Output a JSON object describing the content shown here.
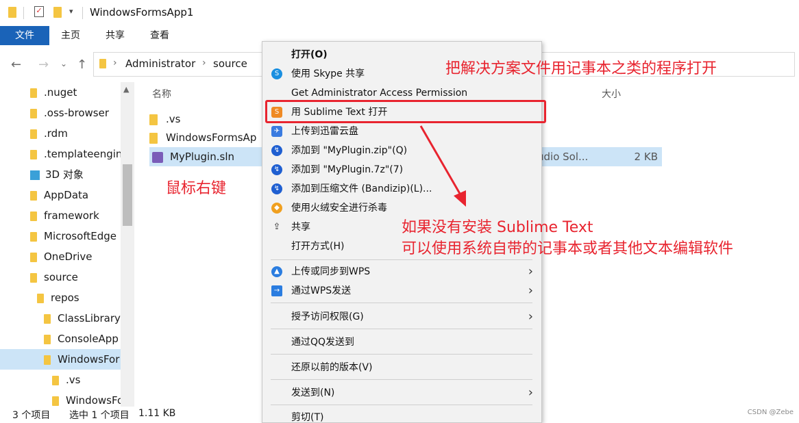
{
  "window": {
    "title": "WindowsFormsApp1"
  },
  "ribbon": {
    "tabs": [
      "文件",
      "主页",
      "共享",
      "查看"
    ]
  },
  "address": {
    "crumbs": [
      "Administrator",
      "source"
    ]
  },
  "sidebar": {
    "items": [
      ".nuget",
      ".oss-browser",
      ".rdm",
      ".templateengin",
      "3D 对象",
      "AppData",
      "framework",
      "MicrosoftEdge",
      "OneDrive",
      "source",
      "repos",
      "ClassLibrary",
      "ConsoleApp",
      "WindowsFor",
      ".vs",
      "WindowsFo"
    ]
  },
  "filelist": {
    "col_name": "名称",
    "col_size": "大小",
    "rows": [
      {
        "name": ".vs"
      },
      {
        "name": "WindowsFormsAp"
      },
      {
        "name": "MyPlugin.sln",
        "type": "udio Sol...",
        "size": "2 KB"
      }
    ]
  },
  "status": {
    "count": "3 个项目",
    "selected": "选中 1 个项目",
    "size": "1.11 KB"
  },
  "context_menu": {
    "items": [
      "打开(O)",
      "使用 Skype 共享",
      "Get Administrator Access Permission",
      "用 Sublime Text 打开",
      "上传到迅雷云盘",
      "添加到 \"MyPlugin.zip\"(Q)",
      "添加到 \"MyPlugin.7z\"(7)",
      "添加到压缩文件 (Bandizip)(L)...",
      "使用火绒安全进行杀毒",
      "共享",
      "打开方式(H)",
      "上传或同步到WPS",
      "通过WPS发送",
      "授予访问权限(G)",
      "通过QQ发送到",
      "还原以前的版本(V)",
      "发送到(N)",
      "剪切(T)"
    ]
  },
  "annotations": {
    "top": "把解决方案文件用记事本之类的程序打开",
    "right_click": "鼠标右键",
    "line1": "如果没有安装 Sublime Text",
    "line2": "可以使用系统自带的记事本或者其他文本编辑软件"
  },
  "watermark": "CSDN @Zebe",
  "colors": {
    "annotation": "#e8242f",
    "file_tab": "#1a63b8",
    "selection": "#cce4f7"
  }
}
